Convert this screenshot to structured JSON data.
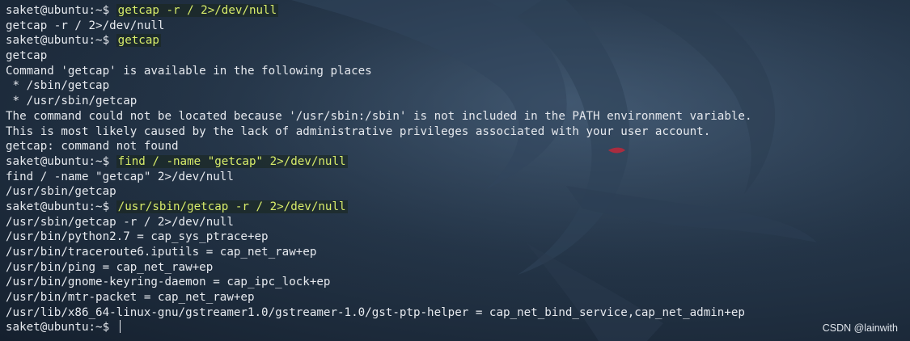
{
  "terminal": {
    "lines": [
      {
        "prompt": "saket@ubuntu:~$",
        "command": "getcap -r / 2>/dev/null"
      },
      {
        "text": "getcap -r / 2>/dev/null"
      },
      {
        "prompt": "saket@ubuntu:~$",
        "command": "getcap"
      },
      {
        "text": "getcap"
      },
      {
        "text": "Command 'getcap' is available in the following places"
      },
      {
        "text": " * /sbin/getcap"
      },
      {
        "text": " * /usr/sbin/getcap"
      },
      {
        "text": "The command could not be located because '/usr/sbin:/sbin' is not included in the PATH environment variable."
      },
      {
        "text": "This is most likely caused by the lack of administrative privileges associated with your user account."
      },
      {
        "text": "getcap: command not found"
      },
      {
        "prompt": "saket@ubuntu:~$",
        "command": "find / -name \"getcap\" 2>/dev/null"
      },
      {
        "text": "find / -name \"getcap\" 2>/dev/null"
      },
      {
        "text": "/usr/sbin/getcap"
      },
      {
        "prompt": "saket@ubuntu:~$",
        "command": "/usr/sbin/getcap -r / 2>/dev/null"
      },
      {
        "text": "/usr/sbin/getcap -r / 2>/dev/null"
      },
      {
        "text": "/usr/bin/python2.7 = cap_sys_ptrace+ep"
      },
      {
        "text": "/usr/bin/traceroute6.iputils = cap_net_raw+ep"
      },
      {
        "text": "/usr/bin/ping = cap_net_raw+ep"
      },
      {
        "text": "/usr/bin/gnome-keyring-daemon = cap_ipc_lock+ep"
      },
      {
        "text": "/usr/bin/mtr-packet = cap_net_raw+ep"
      },
      {
        "text": "/usr/lib/x86_64-linux-gnu/gstreamer1.0/gstreamer-1.0/gst-ptp-helper = cap_net_bind_service,cap_net_admin+ep"
      },
      {
        "prompt": "saket@ubuntu:~$",
        "command": ""
      }
    ]
  },
  "watermark": "CSDN @lainwith",
  "colors": {
    "command_highlight": "#d8ec6a",
    "text": "#e6e9ee",
    "background": "#243548",
    "dragon_eye": "#c0283a"
  },
  "icons": {
    "background": "kali-dragon-logo"
  }
}
